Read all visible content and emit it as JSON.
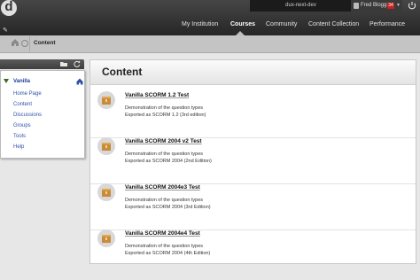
{
  "header": {
    "logo_letter": "d",
    "instance_name": "dux-next-dev",
    "user_name": "Fred Bloggs",
    "notification_count": "34",
    "nav_tabs": [
      "My Institution",
      "Courses",
      "Community",
      "Content Collection",
      "Performance"
    ],
    "active_tab": "Courses"
  },
  "breadcrumb": {
    "current": "Content"
  },
  "course_menu": {
    "course_name": "Vanilla",
    "links": [
      "Home Page",
      "Content",
      "Discussions",
      "Groups",
      "Tools",
      "Help"
    ]
  },
  "content": {
    "title": "Content",
    "items": [
      {
        "title": "Vanilla SCORM 1.2 Test",
        "line1": "Demonstration of the question types",
        "line2": "Exported as SCORM 1.2 (3rd edition)"
      },
      {
        "title": "Vanilla SCORM 2004 v2 Test",
        "line1": "Demonstration of the question types",
        "line2": "Exported as SCORM 2004 (2nd Edition)"
      },
      {
        "title": "Vanilla SCORM 2004e3 Test",
        "line1": "Demonstration of the question types",
        "line2": "Exported as SCORM 2004 (3rd Edition)"
      },
      {
        "title": "Vanilla SCORM 2004e4 Test",
        "line1": "Demonstration of the question types",
        "line2": "Exported as SCORM 2004 (4th Edition)"
      }
    ]
  },
  "colors": {
    "accent_link": "#2f52a8",
    "badge": "#cc2121",
    "header_bg": "#2c2c2c"
  }
}
